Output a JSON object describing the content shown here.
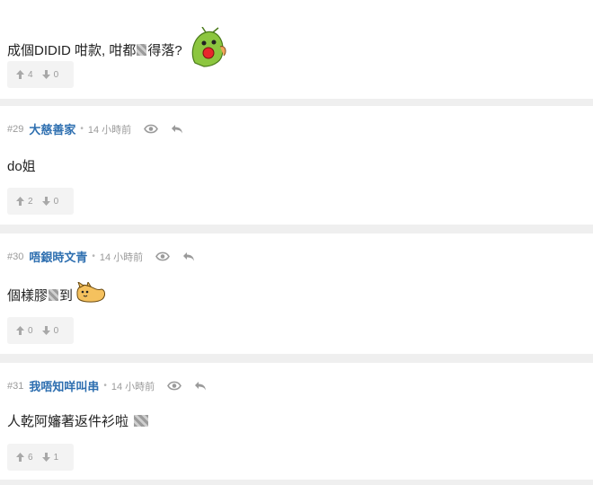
{
  "posts": [
    {
      "body_before": "成個DIDID 咁款, 咁都",
      "body_after": "得落?",
      "sticker": "green-cucumber-sticker",
      "upvotes": "4",
      "downvotes": "0"
    },
    {
      "number": "#29",
      "username": "大慈善家",
      "separator": "•",
      "time": "14 小時前",
      "body_before": "do姐",
      "upvotes": "2",
      "downvotes": "0"
    },
    {
      "number": "#30",
      "username": "唔銀時文青",
      "separator": "•",
      "time": "14 小時前",
      "body_before": "個樣膠",
      "body_after": "到",
      "sticker": "dog-sticker",
      "upvotes": "0",
      "downvotes": "0"
    },
    {
      "number": "#31",
      "username": "我唔知咩叫串",
      "separator": "•",
      "time": "14 小時前",
      "body_before": "人乾阿嬸著返件衫啦",
      "upvotes": "6",
      "downvotes": "1"
    }
  ],
  "icons": {
    "view": "eye-icon",
    "reply": "reply-icon",
    "upvote": "arrow-up-icon",
    "downvote": "arrow-down-icon"
  },
  "colors": {
    "username": "#2e6fb0",
    "meta": "#9a9a9a",
    "background": "#efefef",
    "card": "#ffffff",
    "vote_box": "#f3f3f3"
  }
}
